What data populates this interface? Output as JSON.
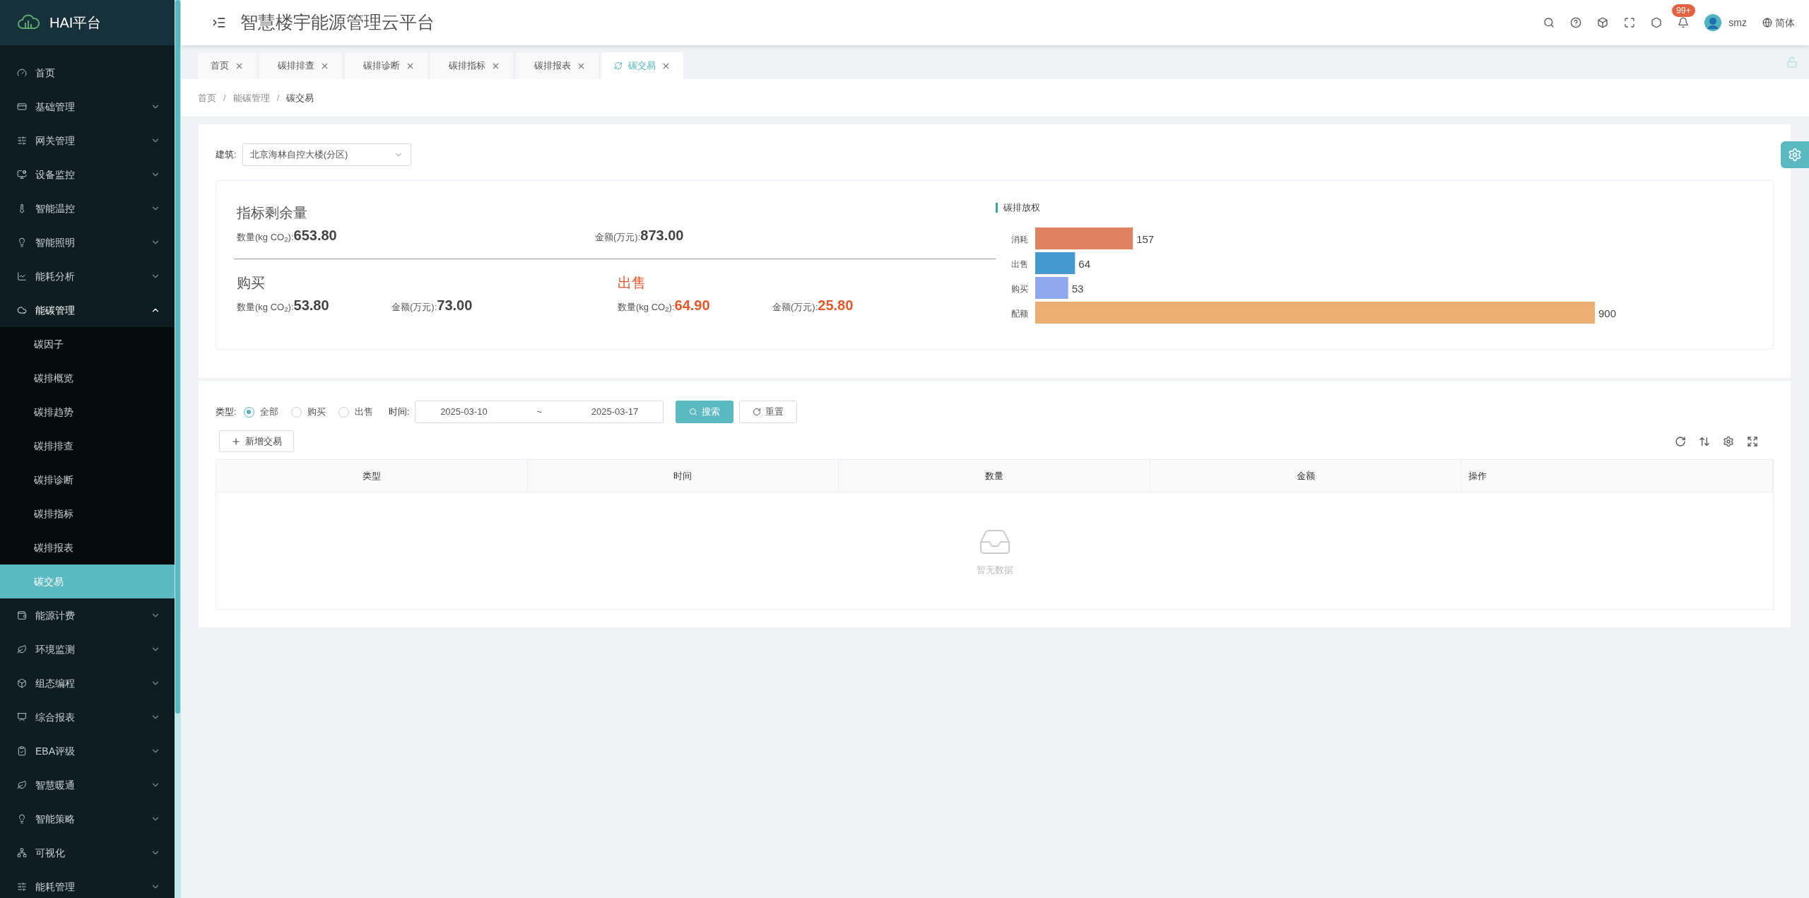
{
  "sidebar": {
    "brand": "HAI平台",
    "items": [
      {
        "label": "首页",
        "has_submenu": false,
        "expanded": false
      },
      {
        "label": "基础管理",
        "has_submenu": true,
        "expanded": false
      },
      {
        "label": "网关管理",
        "has_submenu": true,
        "expanded": false
      },
      {
        "label": "设备监控",
        "has_submenu": true,
        "expanded": false
      },
      {
        "label": "智能温控",
        "has_submenu": true,
        "expanded": false
      },
      {
        "label": "智能照明",
        "has_submenu": true,
        "expanded": false
      },
      {
        "label": "能耗分析",
        "has_submenu": true,
        "expanded": false
      },
      {
        "label": "能碳管理",
        "has_submenu": true,
        "expanded": true,
        "children": [
          {
            "label": "碳因子",
            "selected": false
          },
          {
            "label": "碳排概览",
            "selected": false
          },
          {
            "label": "碳排趋势",
            "selected": false
          },
          {
            "label": "碳排排查",
            "selected": false
          },
          {
            "label": "碳排诊断",
            "selected": false
          },
          {
            "label": "碳排指标",
            "selected": false
          },
          {
            "label": "碳排报表",
            "selected": false
          },
          {
            "label": "碳交易",
            "selected": true
          }
        ]
      },
      {
        "label": "能源计费",
        "has_submenu": true,
        "expanded": false
      },
      {
        "label": "环境监测",
        "has_submenu": true,
        "expanded": false
      },
      {
        "label": "组态编程",
        "has_submenu": true,
        "expanded": false
      },
      {
        "label": "综合报表",
        "has_submenu": true,
        "expanded": false
      },
      {
        "label": "EBA评级",
        "has_submenu": true,
        "expanded": false
      },
      {
        "label": "智慧暖通",
        "has_submenu": true,
        "expanded": false
      },
      {
        "label": "智能策略",
        "has_submenu": true,
        "expanded": false
      },
      {
        "label": "可视化",
        "has_submenu": true,
        "expanded": false
      },
      {
        "label": "能耗管理",
        "has_submenu": true,
        "expanded": false
      }
    ]
  },
  "header": {
    "title": "智慧楼宇能源管理云平台",
    "notification_badge": "99+",
    "user": "smz",
    "language": "简体"
  },
  "tabs": [
    {
      "label": "首页",
      "selected": false
    },
    {
      "label": "碳排排查",
      "selected": false
    },
    {
      "label": "碳排诊断",
      "selected": false
    },
    {
      "label": "碳排指标",
      "selected": false
    },
    {
      "label": "碳排报表",
      "selected": false
    },
    {
      "label": "碳交易",
      "selected": true
    }
  ],
  "breadcrumb": {
    "separator": "/",
    "items": [
      "首页",
      "能碳管理",
      "碳交易"
    ]
  },
  "building": {
    "label": "建筑:",
    "value": "北京海林自控大楼(分区)"
  },
  "summary": {
    "remaining": {
      "title": "指标剩余量",
      "quantity_label": "数量(kg CO$_{2}$):",
      "quantity": "653.80",
      "amount_label": "金额(万元):",
      "amount": "873.00"
    },
    "buy": {
      "title": "购买",
      "quantity_label": "数量(kg CO$_{2}$):",
      "quantity": "53.80",
      "amount_label": "金额(万元):",
      "amount": "73.00"
    },
    "sell": {
      "title": "出售",
      "quantity_label": "数量(kg CO$_{2}$):",
      "quantity": "64.90",
      "amount_label": "金额(万元):",
      "amount": "25.80"
    }
  },
  "chart": {
    "title": "碳排放权",
    "chart_data": {
      "type": "bar",
      "orientation": "horizontal",
      "data_labels": true,
      "series": [
        {
          "name": "消耗",
          "color": "#e0825f",
          "values": [
            157
          ]
        },
        {
          "name": "出售",
          "color": "#4399d0",
          "values": [
            64
          ]
        },
        {
          "name": "购买",
          "color": "#8fa8ee",
          "values": [
            53
          ]
        },
        {
          "name": "配额",
          "color": "#ecae72",
          "values": [
            900
          ]
        }
      ]
    }
  },
  "filters": {
    "type_label": "类型:",
    "type_options": [
      {
        "label": "全部",
        "selected": true
      },
      {
        "label": "购买",
        "selected": false
      },
      {
        "label": "出售",
        "selected": false
      }
    ],
    "time_label": "时间:",
    "start_date": "2025-03-10",
    "separator": "~",
    "end_date": "2025-03-17",
    "search_button": "搜索",
    "reset_button": "重置"
  },
  "add_button": "新增交易",
  "table": {
    "columns": [
      "类型",
      "时间",
      "数量",
      "金额",
      "操作"
    ],
    "empty_text": "暂无数据"
  }
}
